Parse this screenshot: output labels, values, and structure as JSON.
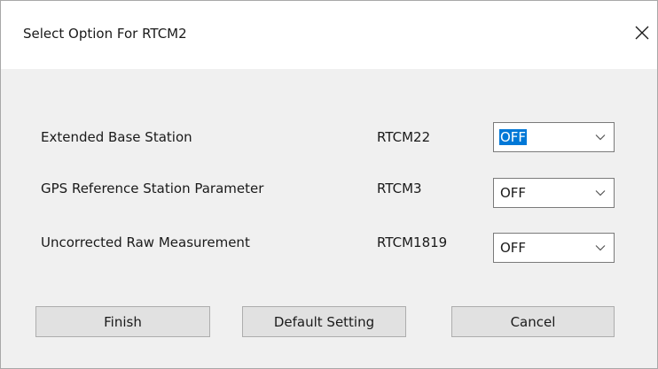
{
  "window": {
    "title": "Select Option For RTCM2"
  },
  "rows": [
    {
      "label": "Extended Base Station",
      "code": "RTCM22",
      "value": "OFF"
    },
    {
      "label": "GPS Reference Station Parameter",
      "code": "RTCM3",
      "value": "OFF"
    },
    {
      "label": "Uncorrected Raw Measurement",
      "code": "RTCM1819",
      "value": "OFF"
    }
  ],
  "buttons": {
    "finish": "Finish",
    "default": "Default Setting",
    "cancel": "Cancel"
  },
  "colors": {
    "selection_highlight": "#0078d7",
    "dialog_bg": "#f0f0f0",
    "button_bg": "#e1e1e1"
  },
  "icons": {
    "close": "close-icon",
    "dropdown": "chevron-down-icon"
  }
}
